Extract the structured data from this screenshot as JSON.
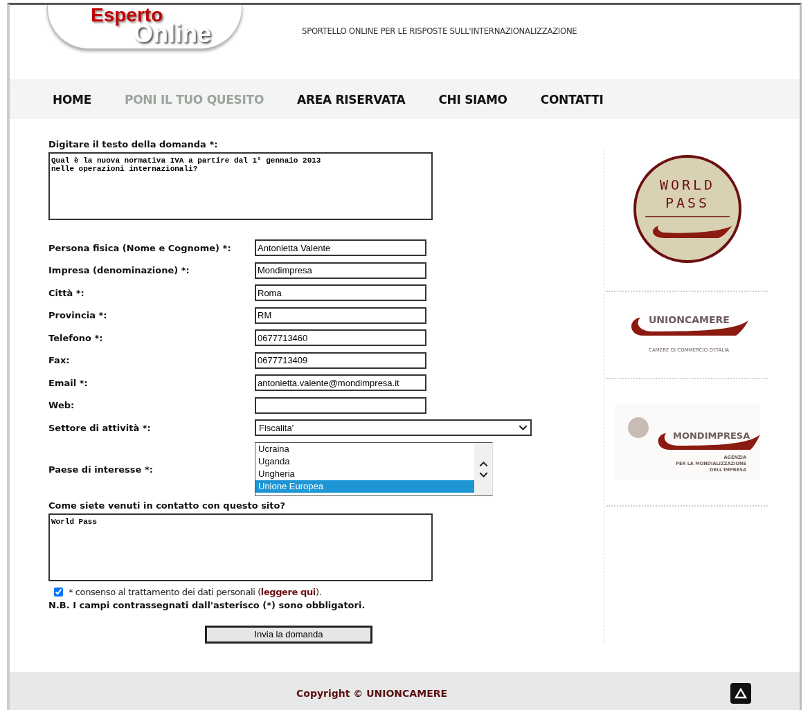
{
  "header": {
    "logo_top": "Esperto",
    "logo_bottom": "Online",
    "tagline": "SPORTELLO ONLINE PER LE RISPOSTE SULL'INTERNAZIONALIZZAZIONE"
  },
  "nav": [
    {
      "label": "HOME",
      "selected": false
    },
    {
      "label": "PONI IL TUO QUESITO",
      "selected": true
    },
    {
      "label": "AREA RISERVATA",
      "selected": false
    },
    {
      "label": "CHI SIAMO",
      "selected": false
    },
    {
      "label": "CONTATTI",
      "selected": false
    }
  ],
  "question": {
    "label": "Digitare il testo della domanda *:",
    "value": "Qual è la nuova normativa IVA a partire dal 1° gennaio 2013\nnelle operazioni internazionali?"
  },
  "fields": [
    {
      "kind": "text",
      "label": "Persona fisica (Nome e Cognome) *:",
      "value": "Antonietta Valente"
    },
    {
      "kind": "text",
      "label": "Impresa (denominazione) *:",
      "value": "Mondimpresa"
    },
    {
      "kind": "text",
      "label": "Città *:",
      "value": "Roma"
    },
    {
      "kind": "text",
      "label": "Provincia *:",
      "value": "RM"
    },
    {
      "kind": "text",
      "label": "Telefono *:",
      "value": "0677713460"
    },
    {
      "kind": "text",
      "label": "Fax:",
      "value": "0677713409"
    },
    {
      "kind": "text",
      "label": "Email *:",
      "value": "antonietta.valente@mondimpresa.it"
    },
    {
      "kind": "text",
      "label": "Web:"
    },
    {
      "kind": "select",
      "label": "Settore di attività *:",
      "value": "Fiscalita'"
    },
    {
      "kind": "listbox",
      "label": "Paese di interesse *:",
      "options": [
        {
          "label": "Ucraina",
          "selected": false
        },
        {
          "label": "Uganda",
          "selected": false
        },
        {
          "label": "Ungheria",
          "selected": false
        },
        {
          "label": "Unione Europea",
          "selected": true
        }
      ]
    }
  ],
  "contact": {
    "label": "Come siete venuti in contatto con questo sito?",
    "value": "World Pass"
  },
  "consent": {
    "checked": true,
    "text_before": "* consenso al trattamento dei dati personali (",
    "link": "leggere qui",
    "text_after": ")."
  },
  "note": "N.B. I campi contrassegnati dall'asterisco (*) sono obbligatori.",
  "submit": "Invia la domanda",
  "sidebar": {
    "worldpass": {
      "line1": "WORLD",
      "line2": "PASS"
    },
    "unioncamere": {
      "name": "UNIONCAMERE",
      "subtitle": "CAMERE DI COMMERCIO D'ITALIA"
    },
    "mondimpresa": {
      "name": "MONDIMPRESA",
      "lines": [
        "AGENZIA",
        "PER LA MONDIALIZZAZIONE",
        "DELL'IMPRESA"
      ]
    }
  },
  "footer": {
    "copyright": "Copyright © UNIONCAMERE"
  }
}
